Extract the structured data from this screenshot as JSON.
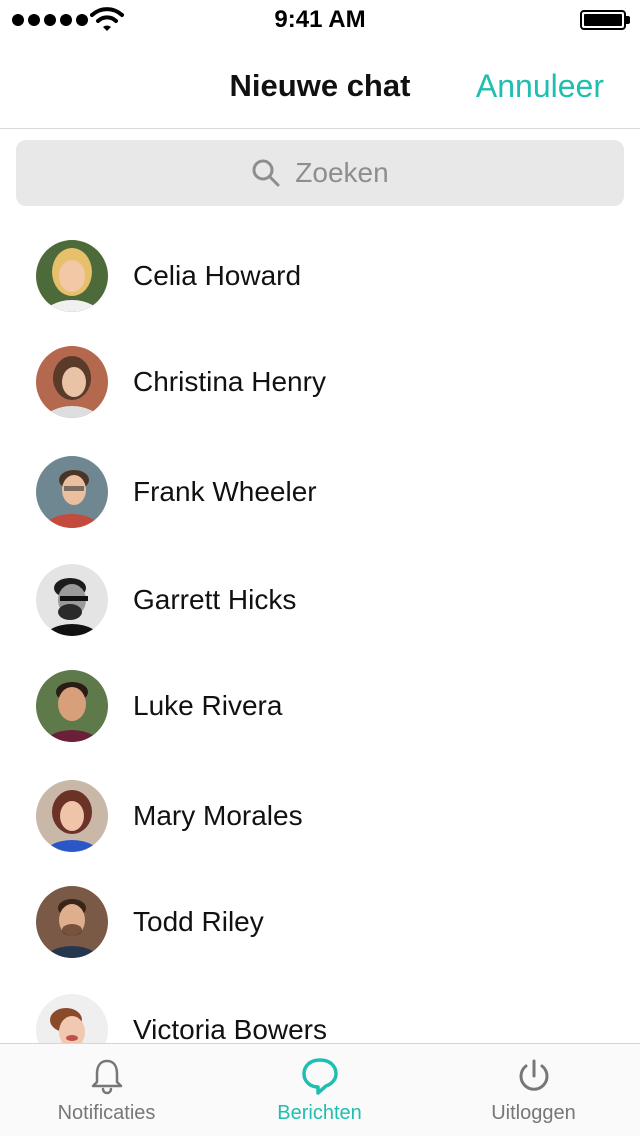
{
  "status_bar": {
    "time": "9:41 AM",
    "signal_icon": "signal-dots-icon",
    "wifi_icon": "wifi-icon",
    "battery_icon": "battery-icon"
  },
  "header": {
    "title": "Nieuwe chat",
    "cancel_label": "Annuleer"
  },
  "search": {
    "placeholder": "Zoeken",
    "icon": "search-icon"
  },
  "contacts": [
    {
      "name": "Celia Howard"
    },
    {
      "name": "Christina Henry"
    },
    {
      "name": "Frank Wheeler"
    },
    {
      "name": "Garrett Hicks"
    },
    {
      "name": "Luke Rivera"
    },
    {
      "name": "Mary Morales"
    },
    {
      "name": "Todd Riley"
    },
    {
      "name": "Victoria Bowers"
    }
  ],
  "tabs": [
    {
      "label": "Notificaties",
      "icon": "bell-icon",
      "active": false
    },
    {
      "label": "Berichten",
      "icon": "chat-bubble-icon",
      "active": true
    },
    {
      "label": "Uitloggen",
      "icon": "power-icon",
      "active": false
    }
  ],
  "colors": {
    "accent": "#1fbfb0",
    "inactive_tab": "#777777",
    "search_bg": "#e8e8e8"
  }
}
